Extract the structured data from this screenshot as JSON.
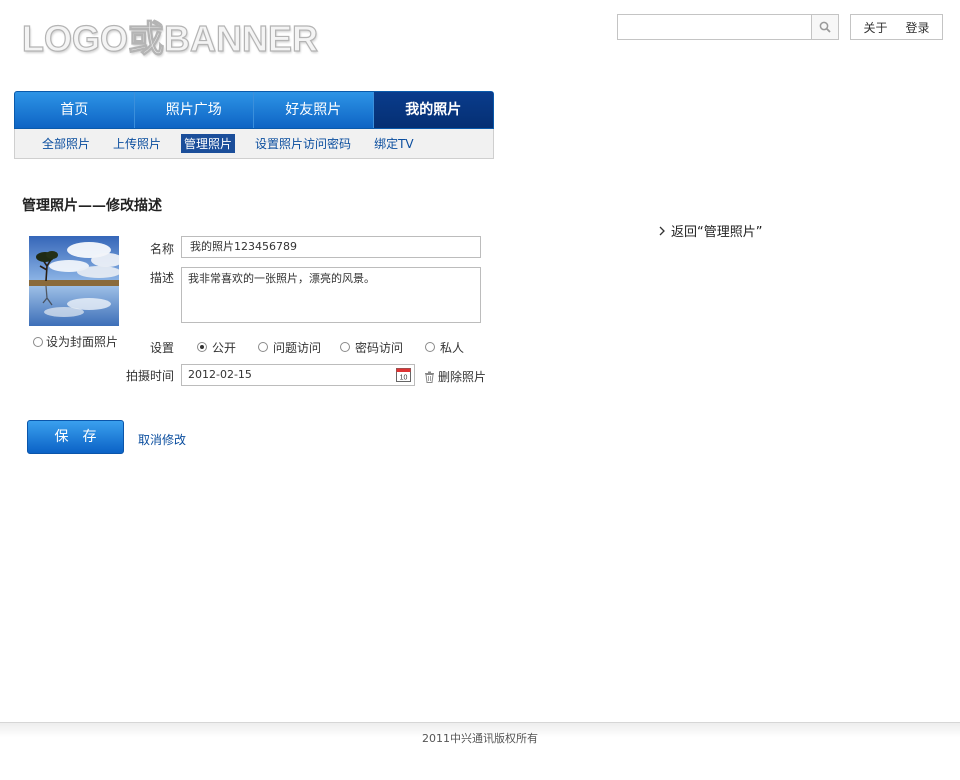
{
  "header": {
    "logo_text": "LOGO或BANNER",
    "search_placeholder": "",
    "about_label": "关于",
    "login_label": "登录"
  },
  "nav": {
    "tabs": [
      {
        "label": "首页",
        "active": false
      },
      {
        "label": "照片广场",
        "active": false
      },
      {
        "label": "好友照片",
        "active": false
      },
      {
        "label": "我的照片",
        "active": true
      }
    ],
    "subtabs": [
      {
        "label": "全部照片",
        "active": false
      },
      {
        "label": "上传照片",
        "active": false
      },
      {
        "label": "管理照片",
        "active": true
      },
      {
        "label": "设置照片访问密码",
        "active": false
      },
      {
        "label": "绑定TV",
        "active": false
      }
    ]
  },
  "page": {
    "title": "管理照片——修改描述",
    "back_link": "返回“管理照片”"
  },
  "photo": {
    "cover_label": "设为封面照片",
    "cover_checked": false
  },
  "form": {
    "name_label": "名称",
    "name_value": "我的照片123456789",
    "desc_label": "描述",
    "desc_value": "我非常喜欢的一张照片，漂亮的风景。",
    "privacy_label": "设置",
    "privacy_options": [
      {
        "label": "公开",
        "checked": true
      },
      {
        "label": "问题访问",
        "checked": false
      },
      {
        "label": "密码访问",
        "checked": false
      },
      {
        "label": "私人",
        "checked": false
      }
    ],
    "date_label": "拍摄时间",
    "date_value": "2012-02-15",
    "calendar_day": "10",
    "delete_label": "删除照片"
  },
  "actions": {
    "save_label": "保存",
    "cancel_label": "取消修改"
  },
  "footer": {
    "copyright": "2011中兴通讯版权所有"
  },
  "colors": {
    "nav_blue": "#0e64c4",
    "nav_active": "#052f73",
    "link_blue": "#0a4d9e",
    "subnav_active_bg": "#1b4e9a"
  }
}
